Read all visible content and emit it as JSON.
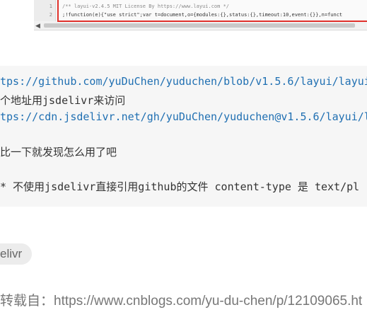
{
  "screenshot": {
    "line_numbers": [
      "1",
      "2"
    ],
    "lines": [
      "/** layui-v2.4.5 MIT License By https://www.layui.com */",
      " ;!function(e){\"use strict\";var t=document,o={modules:{},status:{},timeout:10,event:{}},n=funct"
    ],
    "scroll_left_arrow": "◀"
  },
  "code": {
    "line1": {
      "prefix": "",
      "link": "tps://github.com/yuDuChen/yuduchen/blob/v1.5.6/layui/layui"
    },
    "line2": "个地址用jsdelivr来访问",
    "line3": {
      "prefix": "",
      "link": "tps://cdn.jsdelivr.net/gh/yuDuChen/yuduchen@v1.5.6/layui/la"
    },
    "line4": "比一下就发现怎么用了吧",
    "line5": "* 不使用jsdelivr直接引用github的文件  content-type 是 text/pl"
  },
  "tag": {
    "label": "elivr"
  },
  "repost": {
    "text": "转载自：https://www.cnblogs.com/yu-du-chen/p/12109065.ht"
  }
}
